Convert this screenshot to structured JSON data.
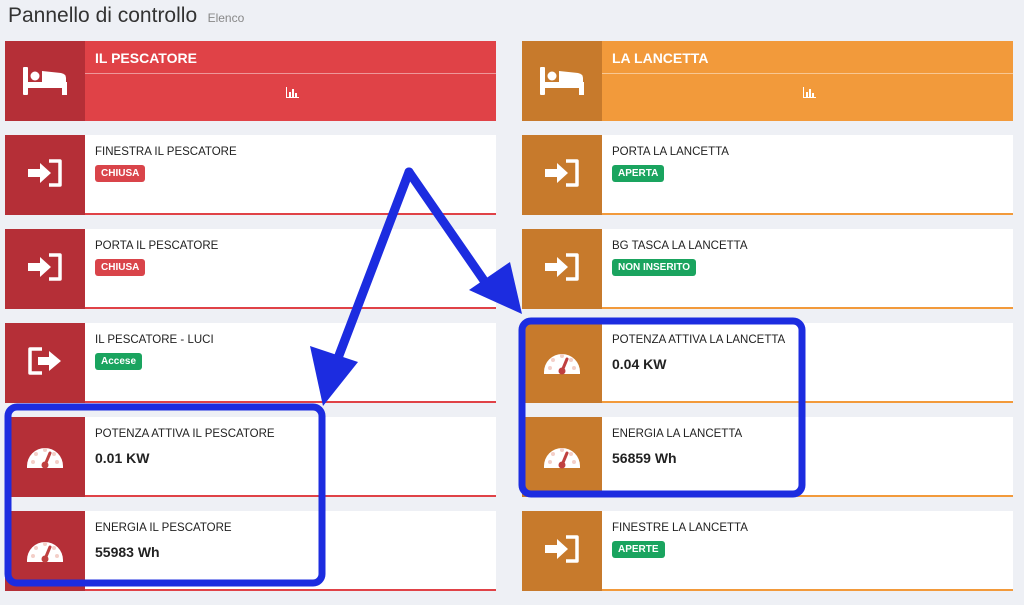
{
  "header": {
    "title": "Pannello di controllo",
    "subtitle": "Elenco"
  },
  "colors": {
    "left_main": "#e04247",
    "left_dark": "#b52f37",
    "right_main": "#f29a3b",
    "right_dark": "#c77a2c",
    "badge_red": "#d9444a",
    "badge_green": "#1aa45f",
    "annotation_blue": "#1c2ce0"
  },
  "left": {
    "room": {
      "name": "IL PESCATORE",
      "icon": "bed-icon",
      "chart_icon": "bar-chart-icon"
    },
    "cards": [
      {
        "label": "FINESTRA IL PESCATORE",
        "badge": "CHIUSA",
        "badge_color": "red",
        "icon": "door-enter-icon"
      },
      {
        "label": "PORTA IL PESCATORE",
        "badge": "CHIUSA",
        "badge_color": "red",
        "icon": "door-enter-icon"
      },
      {
        "label": "IL PESCATORE - LUCI",
        "badge": "Accese",
        "badge_color": "green",
        "icon": "door-exit-icon"
      },
      {
        "label": "POTENZA ATTIVA IL PESCATORE",
        "value": "0.01 KW",
        "icon": "gauge-icon"
      },
      {
        "label": "ENERGIA IL PESCATORE",
        "value": "55983 Wh",
        "icon": "gauge-icon"
      }
    ]
  },
  "right": {
    "room": {
      "name": "LA LANCETTA",
      "icon": "bed-icon",
      "chart_icon": "bar-chart-icon"
    },
    "cards": [
      {
        "label": "PORTA LA LANCETTA",
        "badge": "APERTA",
        "badge_color": "green",
        "icon": "door-enter-icon"
      },
      {
        "label": "BG TASCA LA LANCETTA",
        "badge": "NON INSERITO",
        "badge_color": "green",
        "icon": "door-enter-icon"
      },
      {
        "label": "POTENZA ATTIVA LA LANCETTA",
        "value": "0.04 KW",
        "icon": "gauge-icon"
      },
      {
        "label": "ENERGIA LA LANCETTA",
        "value": "56859 Wh",
        "icon": "gauge-icon"
      },
      {
        "label": "FINESTRE LA LANCETTA",
        "badge": "APERTE",
        "badge_color": "green",
        "icon": "door-enter-icon"
      }
    ]
  }
}
